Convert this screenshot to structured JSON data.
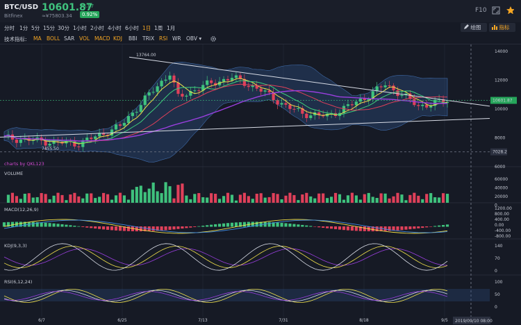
{
  "header": {
    "pair": "BTC/USD",
    "exchange": "Bitfinex",
    "price": "10601.87",
    "change": "96.87",
    "cny": "≈¥75803.34",
    "percent": "0.92%",
    "f10": "F10"
  },
  "timeframes": [
    "分时",
    "1分",
    "5分",
    "15分",
    "30分",
    "1小时",
    "2小时",
    "4小时",
    "6小时",
    "1日",
    "1周",
    "1月"
  ],
  "active_timeframe": "1日",
  "toolbar": {
    "draw_label": "绘图",
    "indicator_label": "指标"
  },
  "indicators": {
    "label": "技术指标:",
    "items": [
      "MA",
      "BOLL",
      "SAR",
      "VOL",
      "MACD",
      "KDJ",
      "BBI",
      "TRIX",
      "RSI",
      "WR",
      "OBV ▾"
    ]
  },
  "chart": {
    "high_label": "13764.00",
    "low_label": "7455.50",
    "current_price_label": "10601.87",
    "dashed_price_label": "7028.2",
    "price_ticks": [
      "14000",
      "12000",
      "10000",
      "8000",
      "6000"
    ],
    "watermark": "charts by QKL123",
    "volume_label": "VOLUME",
    "volume_ticks": [
      "60000",
      "40000",
      "20000",
      "0"
    ],
    "macd_label": "MACD(12,26,9)",
    "macd_ticks": [
      "1200.00",
      "800.00",
      "400.00",
      "0.00",
      "-400.00",
      "-800.00"
    ],
    "kdj_label": "KDJ(9,3,3)",
    "kdj_ticks": [
      "140",
      "70",
      "0"
    ],
    "rsi_label": "RSI(6,12,24)",
    "rsi_ticks": [
      "100",
      "50",
      "0"
    ],
    "x_ticks": [
      "6/7",
      "6/25",
      "7/13",
      "7/31",
      "8/18",
      "9/5"
    ],
    "crosshair_date": "2019/09/10 08:00"
  },
  "colors": {
    "up": "#3fc27d",
    "down": "#e0405a",
    "accent": "#f5a623",
    "background": "#161a25"
  }
}
